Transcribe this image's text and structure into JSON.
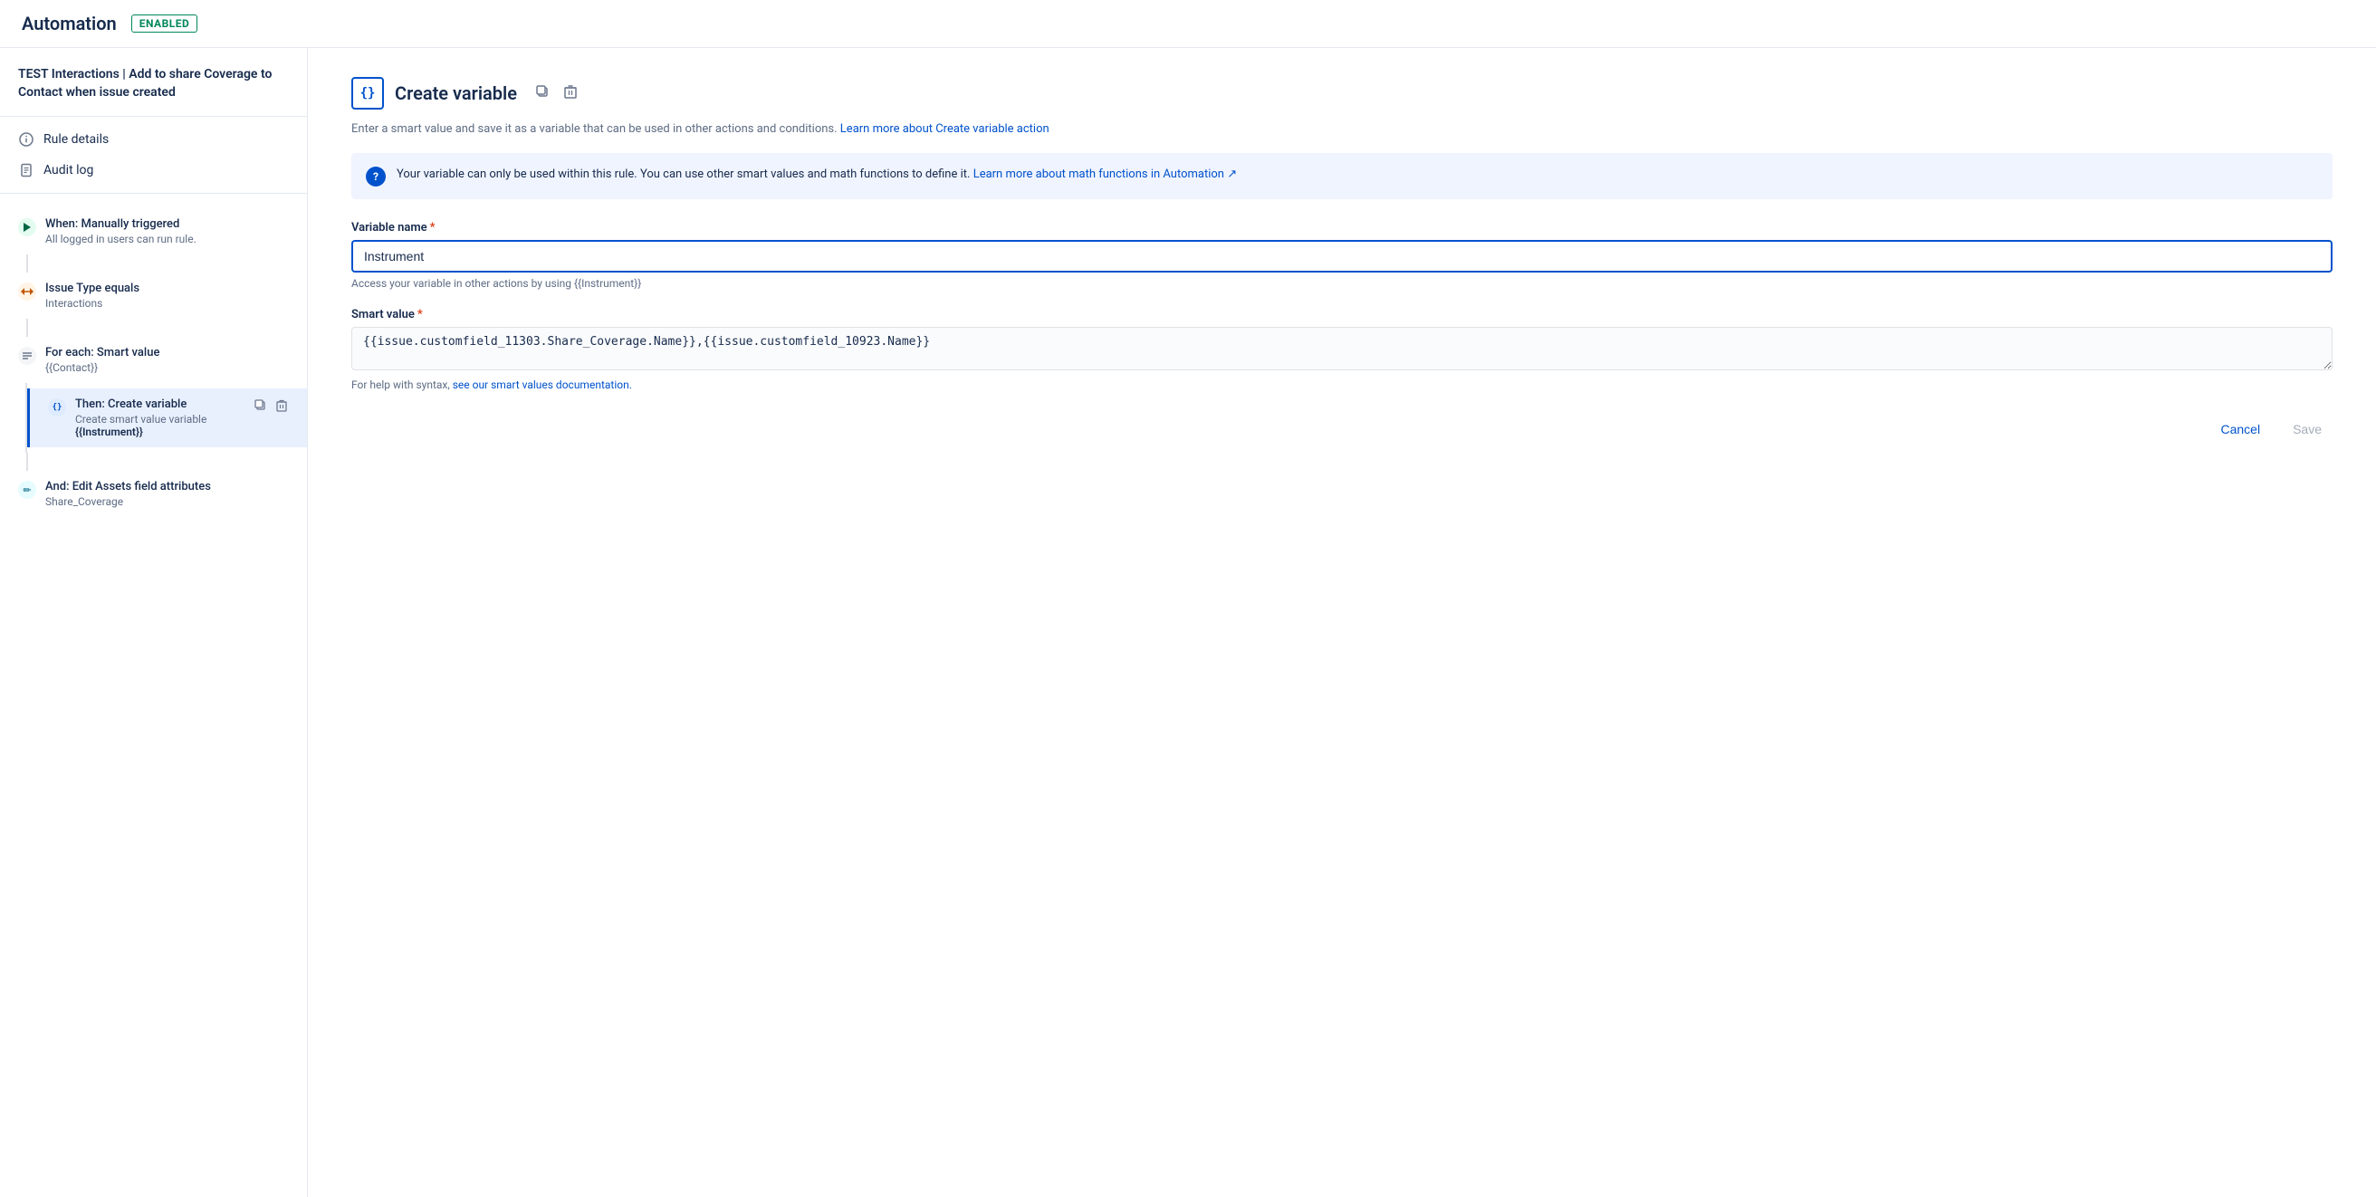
{
  "header": {
    "app_title": "Automation",
    "status_badge": "ENABLED"
  },
  "sidebar": {
    "rule_title": "TEST Interactions | Add to share Coverage to Contact when issue created",
    "nav_items": [
      {
        "id": "rule-details",
        "label": "Rule details",
        "icon": "circle-info"
      },
      {
        "id": "audit-log",
        "label": "Audit log",
        "icon": "file-lines"
      }
    ],
    "flow_items": [
      {
        "id": "when-manually-triggered",
        "label": "When: Manually triggered",
        "sublabel": "All logged in users can run rule.",
        "icon_type": "green",
        "icon_char": "⚡"
      },
      {
        "id": "issue-type-equals",
        "label": "Issue Type equals",
        "sublabel": "Interactions",
        "icon_type": "orange",
        "icon_char": "⇄"
      },
      {
        "id": "for-each-smart-value",
        "label": "For each: Smart value",
        "sublabel": "{{Contact}}",
        "icon_type": "gray",
        "icon_char": "≡"
      }
    ],
    "nested_items": [
      {
        "id": "then-create-variable",
        "label": "Then: Create variable",
        "sublabel": "Create smart value variable",
        "sublabel_bold": "{{Instrument}}",
        "icon_type": "blue",
        "icon_char": "{}",
        "selected": true
      }
    ],
    "after_nested_items": [
      {
        "id": "and-edit-assets",
        "label": "And: Edit Assets field attributes",
        "sublabel": "Share_Coverage",
        "icon_type": "teal",
        "icon_char": "✏"
      }
    ]
  },
  "panel": {
    "title": "Create variable",
    "icon_char": "{}",
    "description_text": "Enter a smart value and save it as a variable that can be used in other actions and conditions.",
    "description_link_text": "Learn more about Create variable action",
    "info_text": "Your variable can only be used within this rule. You can use other smart values and math functions to define it.",
    "info_link_text": "Learn more about math functions in Automation ↗",
    "variable_name_label": "Variable name",
    "variable_name_value": "Instrument",
    "variable_name_hint": "Access your variable in other actions by using {{Instrument}}",
    "smart_value_label": "Smart value",
    "smart_value_value": "{{issue.customfield_11303.Share_Coverage.Name}},{{issue.customfield_10923.Name}}",
    "smart_value_hint_text": "For help with syntax,",
    "smart_value_hint_link": "see our smart values documentation.",
    "cancel_label": "Cancel",
    "save_label": "Save"
  },
  "icons": {
    "copy": "⧉",
    "delete": "🗑",
    "braces": "{}"
  }
}
